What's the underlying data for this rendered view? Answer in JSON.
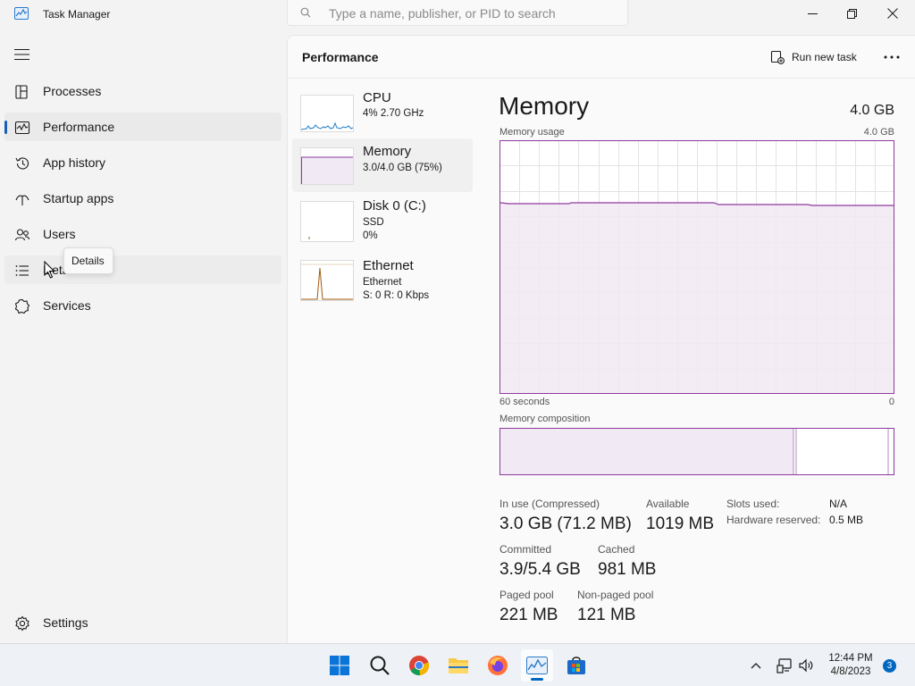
{
  "window": {
    "title": "Task Manager",
    "search_placeholder": "Type a name, publisher, or PID to search"
  },
  "nav": {
    "items": [
      {
        "label": "Processes",
        "icon": "processes-icon"
      },
      {
        "label": "Performance",
        "icon": "performance-icon",
        "active": true
      },
      {
        "label": "App history",
        "icon": "history-icon"
      },
      {
        "label": "Startup apps",
        "icon": "startup-icon"
      },
      {
        "label": "Users",
        "icon": "users-icon"
      },
      {
        "label": "Deta",
        "icon": "details-icon"
      },
      {
        "label": "Services",
        "icon": "services-icon"
      }
    ],
    "settings_label": "Settings",
    "tooltip": "Details"
  },
  "header": {
    "title": "Performance",
    "run_task_label": "Run new task"
  },
  "devices": [
    {
      "name": "CPU",
      "line1": "4% 2.70 GHz",
      "line2": ""
    },
    {
      "name": "Memory",
      "line1": "3.0/4.0 GB (75%)",
      "line2": "",
      "selected": true
    },
    {
      "name": "Disk 0 (C:)",
      "line1": "SSD",
      "line2": "0%"
    },
    {
      "name": "Ethernet",
      "line1": "Ethernet",
      "line2": "S: 0 R: 0 Kbps"
    }
  ],
  "detail": {
    "title": "Memory",
    "total": "4.0 GB",
    "usage_label": "Memory usage",
    "usage_max": "4.0 GB",
    "time_left": "60 seconds",
    "time_right": "0",
    "composition_label": "Memory composition",
    "stats": {
      "in_use_label": "In use (Compressed)",
      "in_use_value": "3.0 GB (71.2 MB)",
      "available_label": "Available",
      "available_value": "1019 MB",
      "committed_label": "Committed",
      "committed_value": "3.9/5.4 GB",
      "cached_label": "Cached",
      "cached_value": "981 MB",
      "paged_label": "Paged pool",
      "paged_value": "221 MB",
      "nonpaged_label": "Non-paged pool",
      "nonpaged_value": "121 MB"
    },
    "slots_label": "Slots used:",
    "slots_value": "N/A",
    "hw_reserved_label": "Hardware reserved:",
    "hw_reserved_value": "0.5 MB",
    "usage_fraction": 0.75,
    "composition_in_use_fraction": 0.75,
    "accent_color": "#8e3a9e",
    "fill_color": "#f1e9f3"
  },
  "taskbar": {
    "apps": [
      "start-icon",
      "search-icon",
      "chrome-icon",
      "file-explorer-icon",
      "firefox-icon",
      "task-manager-icon",
      "store-icon"
    ],
    "time": "12:44 PM",
    "date": "4/8/2023",
    "notification_count": "3"
  }
}
